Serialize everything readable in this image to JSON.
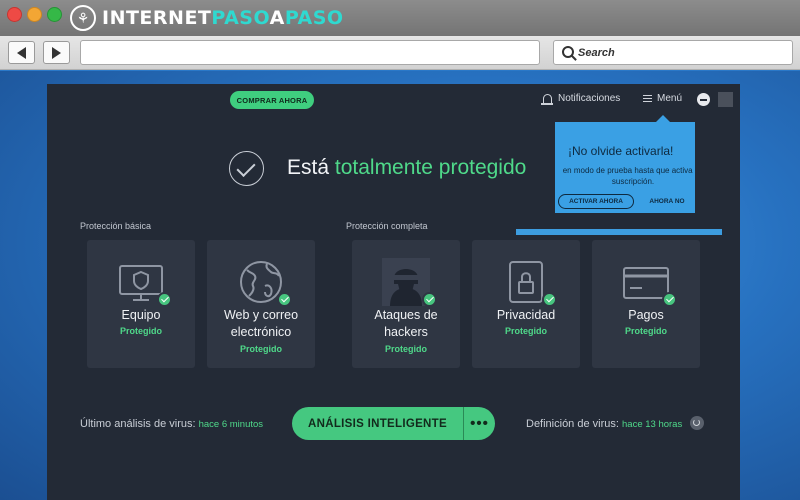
{
  "browser": {
    "site_logo": {
      "part_a": "INTERNET",
      "part_b": "PASO",
      "part_c": "A",
      "part_d": "PASO",
      "icon": "logo-icon"
    },
    "search_placeholder": "Search",
    "back_icon": "back-arrow-icon",
    "forward_icon": "forward-arrow-icon"
  },
  "app": {
    "buy_label": "COMPRAR AHORA",
    "notifications_label": "Notificaciones",
    "menu_label": "Menú",
    "status": {
      "prefix": "Está",
      "highlight": "totalmente protegido"
    },
    "popup": {
      "title": "¡No olvide activarla!",
      "body": "en modo de prueba hasta que activa su suscripción.",
      "activate_label": "ACTIVAR AHORA",
      "later_label": "AHORA NO"
    },
    "sections": {
      "basic": "Protección básica",
      "full": "Protección completa"
    },
    "cards": [
      {
        "title": "Equipo",
        "status": "Protegido",
        "icon": "monitor-shield-icon"
      },
      {
        "title": "Web y correo electrónico",
        "status": "Protegido",
        "icon": "globe-icon"
      },
      {
        "title": "Ataques de hackers",
        "status": "Protegido",
        "icon": "hacker-icon"
      },
      {
        "title": "Privacidad",
        "status": "Protegido",
        "icon": "lock-icon"
      },
      {
        "title": "Pagos",
        "status": "Protegido",
        "icon": "credit-card-icon"
      }
    ],
    "last_scan": {
      "label": "Último análisis de virus:",
      "value": "hace 6 minutos"
    },
    "scan_button": "ANÁLISIS INTELIGENTE",
    "scan_more": "•••",
    "definitions": {
      "label": "Definición de virus:",
      "value": "hace 13 horas"
    }
  },
  "colors": {
    "accent_green": "#45c880",
    "app_bg": "#232a36",
    "card_bg": "#2f3643",
    "popup_blue": "#3aa0e4",
    "logo_cyan": "#2fd9d0"
  }
}
